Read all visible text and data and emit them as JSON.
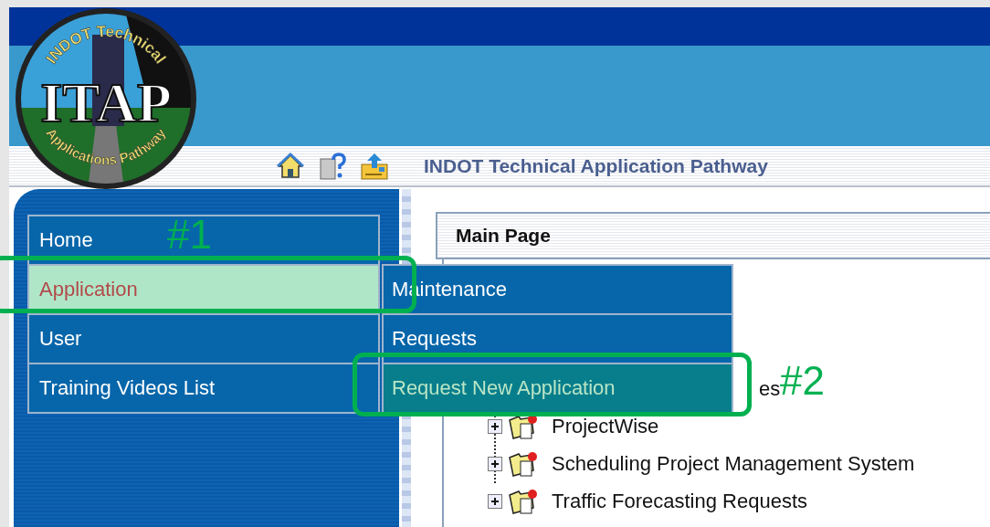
{
  "logo": {
    "top_text": "INDOT Technical",
    "main_text": "ITAP",
    "bottom_text": "Applications Pathway"
  },
  "toolbar": {
    "title": "INDOT Technical Application Pathway"
  },
  "sidebar": {
    "items": [
      {
        "label": "Home",
        "selected": false
      },
      {
        "label": "Application",
        "selected": true
      },
      {
        "label": "User",
        "selected": false
      },
      {
        "label": "Training Videos List",
        "selected": false
      }
    ]
  },
  "submenu": {
    "items": [
      {
        "label": "Maintenance",
        "selected": false
      },
      {
        "label": "Requests",
        "selected": false
      },
      {
        "label": "Request New Application",
        "selected": true
      }
    ]
  },
  "main": {
    "header": "Main Page",
    "tree": [
      {
        "label": "es",
        "kind": "covered"
      },
      {
        "label": "ProjectWise",
        "expanded": false,
        "kind": "node"
      },
      {
        "label": "Scheduling Project Management System",
        "expanded": false,
        "kind": "node"
      },
      {
        "label": "Traffic Forecasting Requests",
        "expanded": false,
        "kind": "node"
      }
    ]
  },
  "callouts": [
    {
      "label": "#1"
    },
    {
      "label": "#2"
    }
  ]
}
